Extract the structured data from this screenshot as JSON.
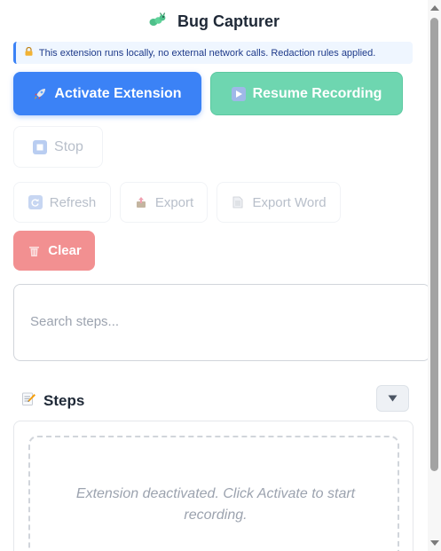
{
  "header": {
    "title": "Bug Capturer",
    "logo_icon": "bug-icon"
  },
  "notice": {
    "text": "This extension runs locally, no external network calls. Redaction rules applied.",
    "icon": "lock-icon"
  },
  "buttons": {
    "activate": {
      "label": "Activate Extension",
      "icon": "rocket-icon"
    },
    "resume": {
      "label": "Resume Recording",
      "icon": "play-icon"
    },
    "stop": {
      "label": "Stop",
      "icon": "stop-icon"
    },
    "refresh": {
      "label": "Refresh",
      "icon": "refresh-icon"
    },
    "export": {
      "label": "Export",
      "icon": "export-icon"
    },
    "export_word": {
      "label": "Export Word",
      "icon": "document-icon"
    },
    "clear": {
      "label": "Clear",
      "icon": "trash-icon"
    }
  },
  "search": {
    "placeholder": "Search steps...",
    "value": ""
  },
  "steps": {
    "title": "Steps",
    "icon": "memo-icon",
    "toggle_icon": "chevron-down-icon",
    "empty_message": "Extension deactivated. Click Activate to start recording."
  },
  "colors": {
    "primary": "#3b82f6",
    "resume": "#6ed6b0",
    "clear": "#f29091",
    "notice_bg": "#eff6ff",
    "disabled_text": "#b8bfca"
  }
}
